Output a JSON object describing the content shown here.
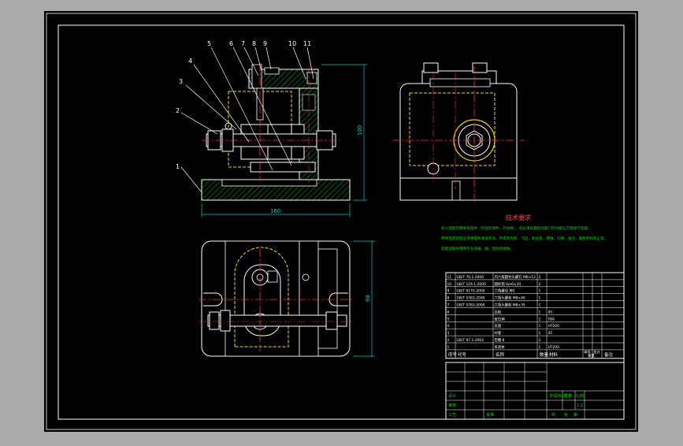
{
  "colors": {
    "outer_bg": "#ababab",
    "sheet": "#000000",
    "line": "#ffffff",
    "hidden": "#ffd700",
    "center": "#ff3030",
    "hatch": "#00b400",
    "dim": "#00c8c8",
    "note_title": "#ff4040",
    "note_text": "#00e000",
    "table": "#ffffff",
    "table_green": "#00e000",
    "table_cyan": "#00d8d8"
  },
  "balloons": [
    "1",
    "2",
    "3",
    "4",
    "5",
    "6",
    "7",
    "8",
    "9",
    "10",
    "11"
  ],
  "dimensions": {
    "front_width": "160",
    "front_height": "100",
    "plan_height": "98"
  },
  "notes": {
    "title": "技术要求",
    "lines": [
      "装入装配的零件及部件（包括外购件、外协件），均必须具有检验部门的合格证方能进行装配。",
      "零件在装配前必须清理和清洗干净，不得有毛刺、飞边、氧化皮、锈蚀、切屑、油污、着色剂和灰尘等。",
      "装配过程中零件不允许磕、碰、划伤和锈蚀。"
    ]
  },
  "parts_list": {
    "rows": [
      {
        "no": "11",
        "code": "GB/T 70.1-2000",
        "name": "内六角圆柱头螺钉 M6×12",
        "qty": "2",
        "material": "",
        "note": ""
      },
      {
        "no": "10",
        "code": "GB/T 119.1-2000",
        "name": "圆柱销 6m6×20",
        "qty": "2",
        "material": "",
        "note": ""
      },
      {
        "no": "9",
        "code": "GB/T 6170-2000",
        "name": "六角螺母 M8",
        "qty": "1",
        "material": "",
        "note": ""
      },
      {
        "no": "8",
        "code": "GB/T 5783-2000",
        "name": "六角头螺栓 M8×40",
        "qty": "1",
        "material": "",
        "note": ""
      },
      {
        "no": "7",
        "code": "GB/T 5783-2000",
        "name": "六角头螺栓 M8×35",
        "qty": "1",
        "material": "",
        "note": ""
      },
      {
        "no": "6",
        "code": "",
        "name": "压板",
        "qty": "1",
        "material": "45",
        "note": ""
      },
      {
        "no": "5",
        "code": "",
        "name": "定位销",
        "qty": "1",
        "material": "T8A",
        "note": ""
      },
      {
        "no": "4",
        "code": "",
        "name": "支座",
        "qty": "1",
        "material": "HT200",
        "note": ""
      },
      {
        "no": "3",
        "code": "",
        "name": "衬套",
        "qty": "1",
        "material": "45",
        "note": ""
      },
      {
        "no": "2",
        "code": "GB/T 97.1-2002",
        "name": "垫圈 8",
        "qty": "2",
        "material": "",
        "note": ""
      },
      {
        "no": "1",
        "code": "",
        "name": "夹具体",
        "qty": "1",
        "material": "HT200",
        "note": ""
      }
    ],
    "header": {
      "no": "序号",
      "code": "代号",
      "name": "名称",
      "qty": "数量",
      "material": "材料",
      "unit_weight": "单件",
      "total_weight": "总计",
      "weight": "重量",
      "note": "备注"
    }
  },
  "title_block": {
    "design": "设计",
    "check": "审核",
    "process": "工艺",
    "approve": "批准",
    "stage_mark": "阶段标记",
    "weight": "重量",
    "scale": "比例",
    "scale_value": "1:1",
    "sheet_total": "共",
    "sheet_of": "张",
    "sheet_no": "第"
  }
}
